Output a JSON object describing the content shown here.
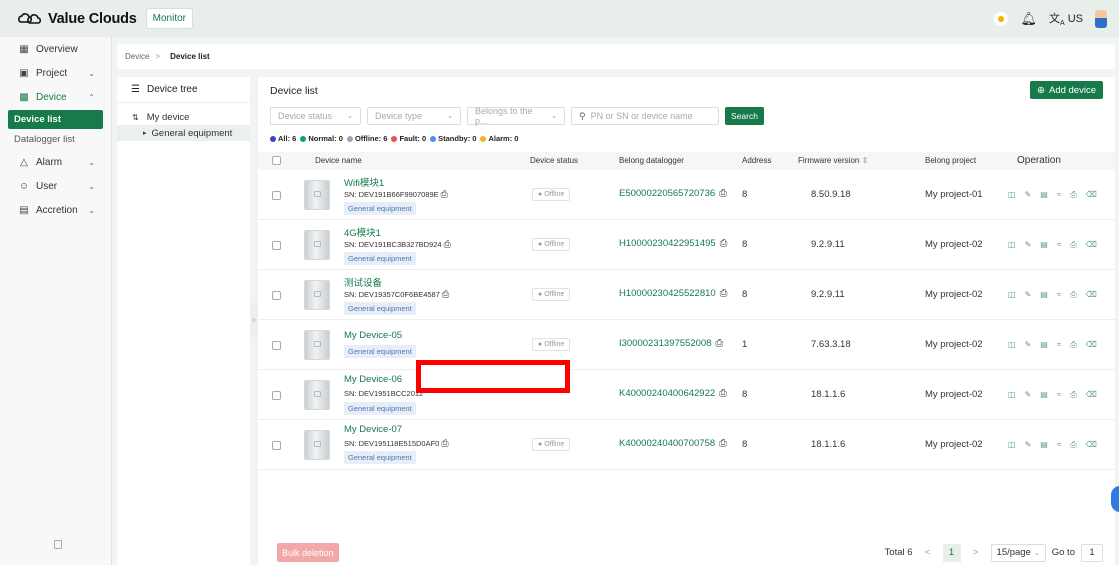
{
  "header": {
    "logo_text": "Value Clouds",
    "monitor_tab": "Monitor",
    "lang": "US",
    "icons": [
      "theme-sun-icon",
      "bell-icon",
      "translate-icon",
      "avatar"
    ]
  },
  "sidebar": {
    "items": [
      {
        "label": "Overview",
        "icon": "dashboard-icon"
      },
      {
        "label": "Project",
        "icon": "project-icon"
      },
      {
        "label": "Device",
        "icon": "device-icon"
      },
      {
        "label": "Alarm",
        "icon": "bell-icon"
      },
      {
        "label": "User",
        "icon": "users-icon"
      },
      {
        "label": "Accretion",
        "icon": "accretion-icon"
      }
    ],
    "device_sub": [
      "Device list",
      "Datalogger list"
    ]
  },
  "breadcrumb": {
    "parent": "Device",
    "current": "Device list"
  },
  "tree": {
    "title": "Device tree",
    "root": "My device",
    "child": "General equipment"
  },
  "main": {
    "title": "Device list",
    "add_button": "Add device",
    "filters": {
      "status": "Device status",
      "type": "Device type",
      "project": "Belongs to the p...",
      "search_placeholder": "PN or SN or device name",
      "search_button": "Search"
    },
    "legend": [
      {
        "label": "All: 6",
        "color": "#3a47c4"
      },
      {
        "label": "Normal: 0",
        "color": "#1aa06a"
      },
      {
        "label": "Offline: 6",
        "color": "#9aa7b8"
      },
      {
        "label": "Fault: 0",
        "color": "#e8534d"
      },
      {
        "label": "Standby: 0",
        "color": "#4e8ef0"
      },
      {
        "label": "Alarm: 0",
        "color": "#f0b429"
      }
    ],
    "columns": [
      "Device name",
      "Device status",
      "Belong datalogger",
      "Address",
      "Firmware version",
      "Belong project",
      "Operation"
    ],
    "rows": [
      {
        "name": "Wifi模块1",
        "sn": "SN: DEV191B66F9907089E",
        "tag": "General equipment",
        "status": "Offline",
        "datalogger": "E50000220565720736",
        "address": "8",
        "firmware": "8.50.9.18",
        "project": "My project-01"
      },
      {
        "name": "4G模块1",
        "sn": "SN: DEV191BC3B327BD924",
        "tag": "General equipment",
        "status": "Offline",
        "datalogger": "H10000230422951495",
        "address": "8",
        "firmware": "9.2.9.11",
        "project": "My project-02"
      },
      {
        "name": "测试设备",
        "sn": "SN: DEV19357C0F6BE4587",
        "tag": "General equipment",
        "status": "Offline",
        "datalogger": "H10000230425522810",
        "address": "8",
        "firmware": "9.2.9.11",
        "project": "My project-02"
      },
      {
        "name": "My Device-05",
        "sn": "",
        "tag": "General equipment",
        "status": "Offline",
        "datalogger": "I30000231397552008",
        "address": "1",
        "firmware": "7.63.3.18",
        "project": "My project-02"
      },
      {
        "name": "My Device-06",
        "sn": "SN: DEV1951BCC2012",
        "tag": "General equipment",
        "status": "",
        "datalogger": "K40000240400642922",
        "address": "8",
        "firmware": "18.1.1.6",
        "project": "My project-02"
      },
      {
        "name": "My Device-07",
        "sn": "SN: DEV195118E515D0AF0",
        "tag": "General equipment",
        "status": "Offline",
        "datalogger": "K40000240400700758",
        "address": "8",
        "firmware": "18.1.1.6",
        "project": "My project-02"
      }
    ],
    "bulk_delete": "Bulk deletion",
    "pagination": {
      "total": "Total 6",
      "page": "1",
      "per_page": "15/page",
      "goto_label": "Go to",
      "goto_value": "1"
    }
  }
}
